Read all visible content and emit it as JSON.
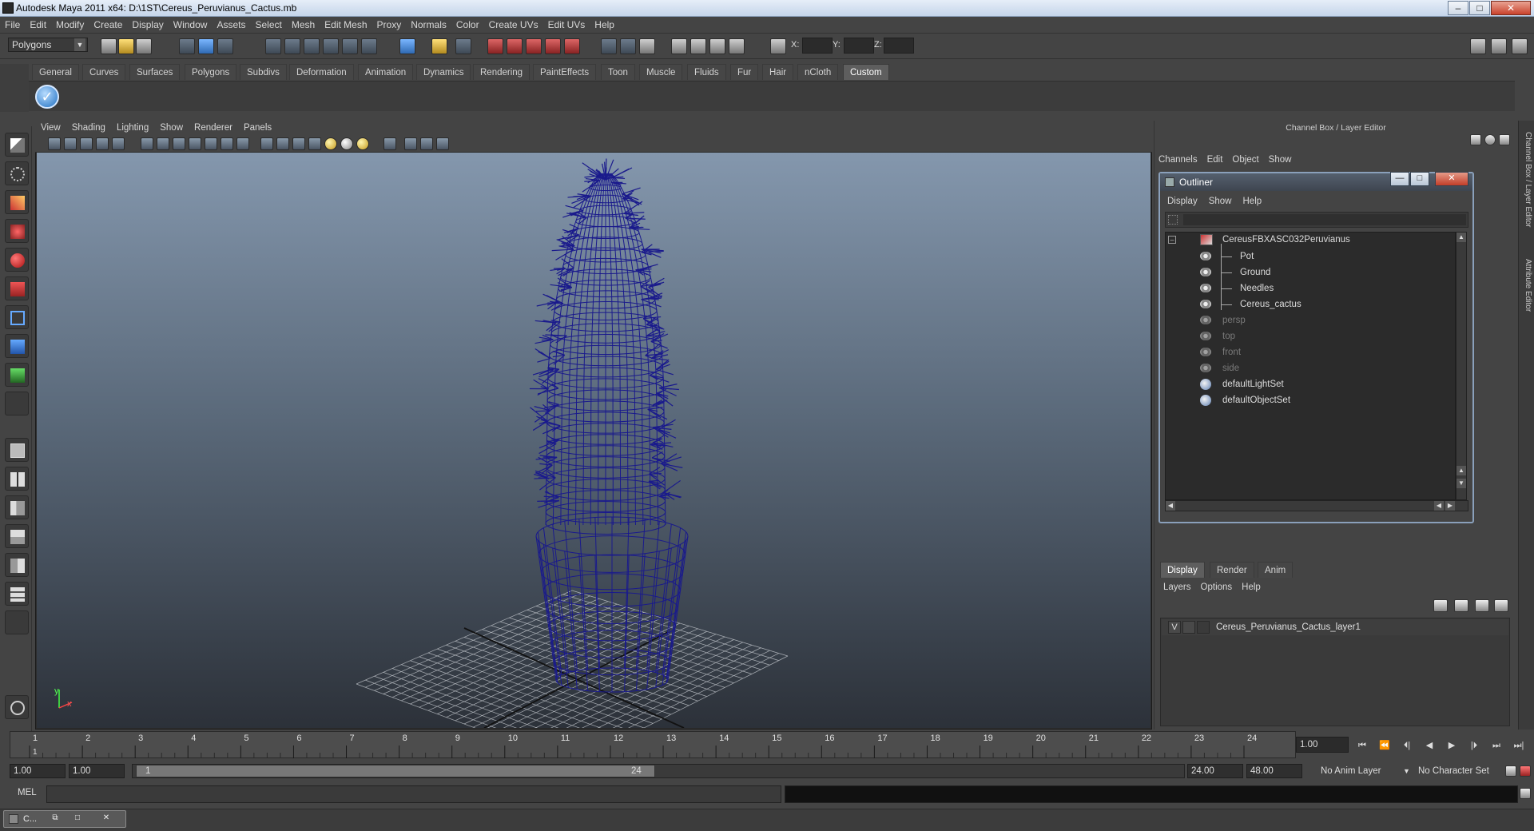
{
  "window": {
    "title": "Autodesk Maya 2011 x64: D:\\1ST\\Cereus_Peruvianus_Cactus.mb",
    "controls": {
      "minimize": "–",
      "maximize": "□",
      "close": "✕"
    }
  },
  "menubar": [
    "File",
    "Edit",
    "Modify",
    "Create",
    "Display",
    "Window",
    "Assets",
    "Select",
    "Mesh",
    "Edit Mesh",
    "Proxy",
    "Normals",
    "Color",
    "Create UVs",
    "Edit UVs",
    "Help"
  ],
  "toolbar": {
    "mode": "Polygons",
    "coord_x": "X:",
    "coord_y": "Y:",
    "coord_z": "Z:"
  },
  "shelf_tabs": [
    "General",
    "Curves",
    "Surfaces",
    "Polygons",
    "Subdivs",
    "Deformation",
    "Animation",
    "Dynamics",
    "Rendering",
    "PaintEffects",
    "Toon",
    "Muscle",
    "Fluids",
    "Fur",
    "Hair",
    "nCloth",
    "Custom"
  ],
  "shelf_active": "Custom",
  "viewport": {
    "menu": [
      "View",
      "Shading",
      "Lighting",
      "Show",
      "Renderer",
      "Panels"
    ],
    "axis_x": "x",
    "axis_y": "y",
    "wire_color": "#1a1a8c"
  },
  "channel_box": {
    "title": "Channel Box / Layer Editor",
    "menu": [
      "Channels",
      "Edit",
      "Object",
      "Show"
    ],
    "side_tabs": [
      "Channel Box / Layer Editor",
      "Attribute Editor"
    ]
  },
  "outliner": {
    "title": "Outliner",
    "menu": [
      "Display",
      "Show",
      "Help"
    ],
    "controls": {
      "minimize": "—",
      "maximize": "□",
      "close": "✕"
    },
    "root": "CereusFBXASC032Peruvianus",
    "children": [
      "Pot",
      "Ground",
      "Needles",
      "Cereus_cactus"
    ],
    "cameras": [
      "persp",
      "top",
      "front",
      "side"
    ],
    "sets": [
      "defaultLightSet",
      "defaultObjectSet"
    ]
  },
  "layer_editor": {
    "tabs": [
      "Display",
      "Render",
      "Anim"
    ],
    "active_tab": "Display",
    "menu": [
      "Layers",
      "Options",
      "Help"
    ],
    "layer": {
      "visible": "V",
      "name": "Cereus_Peruvianus_Cactus_layer1"
    }
  },
  "timeline": {
    "ticks": [
      "1",
      "2",
      "3",
      "4",
      "5",
      "6",
      "7",
      "8",
      "9",
      "10",
      "11",
      "12",
      "13",
      "14",
      "15",
      "16",
      "17",
      "18",
      "19",
      "20",
      "21",
      "22",
      "23",
      "24"
    ],
    "current_marker": "1",
    "current_frame": "1.00",
    "playback": [
      "⏮",
      "⏪",
      "⏴|",
      "◀",
      "▶",
      "|⏵",
      "⏭",
      "⏭|"
    ]
  },
  "range": {
    "start": "1.00",
    "playback_start": "1.00",
    "handle_start": "1",
    "handle_end": "24",
    "playback_end": "24.00",
    "end": "48.00",
    "anim_layer": "No Anim Layer",
    "character_set": "No Character Set"
  },
  "command_line": {
    "label": "MEL"
  },
  "taskbar": {
    "window_label": "C..."
  }
}
